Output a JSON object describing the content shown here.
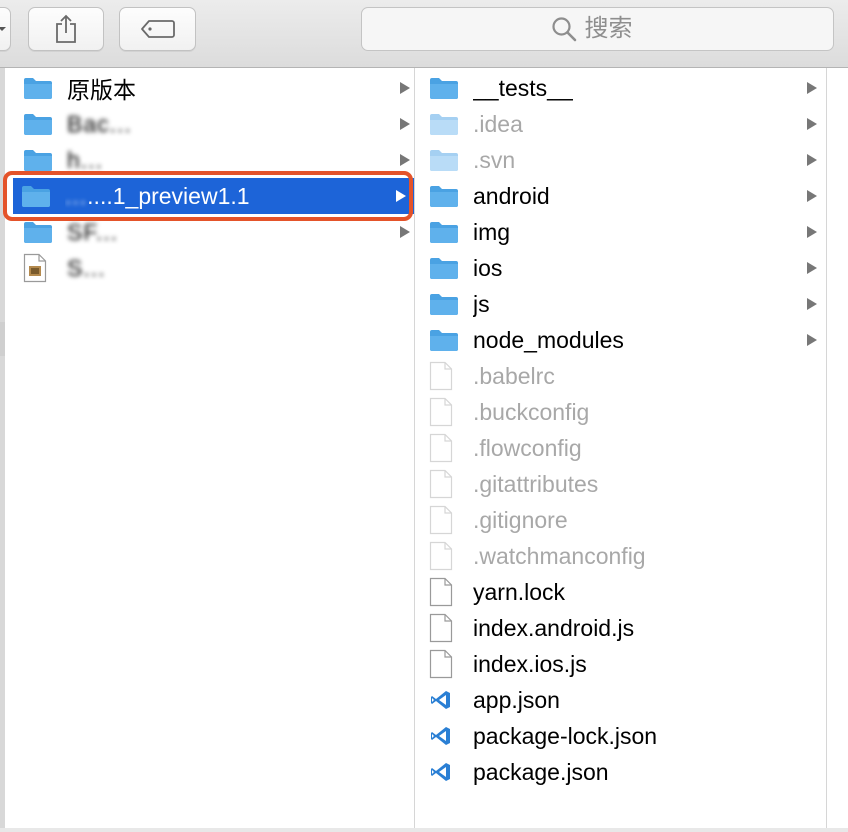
{
  "toolbar": {
    "search_placeholder": "搜索",
    "share_icon": "share-icon",
    "tag_icon": "tag-icon"
  },
  "left_column": {
    "items": [
      {
        "name": "原版本",
        "kind": "folder",
        "arrow": true
      },
      {
        "name": "Bac...",
        "kind": "folder",
        "arrow": true,
        "obscured": true
      },
      {
        "name": "h...",
        "kind": "folder",
        "arrow": true,
        "obscured": true
      },
      {
        "name_prefix": "...",
        "name_suffix": "....1_preview1.1",
        "kind": "folder",
        "arrow": true,
        "selected": true
      },
      {
        "name": "SF...",
        "kind": "folder",
        "arrow": true,
        "obscured": true
      },
      {
        "name": "S...",
        "kind": "document",
        "arrow": false,
        "obscured": true
      }
    ]
  },
  "right_column": {
    "items": [
      {
        "name": "__tests__",
        "kind": "folder",
        "dim": false,
        "arrow": true
      },
      {
        "name": ".idea",
        "kind": "folder",
        "dim": true,
        "arrow": true
      },
      {
        "name": ".svn",
        "kind": "folder",
        "dim": true,
        "arrow": true
      },
      {
        "name": "android",
        "kind": "folder",
        "dim": false,
        "arrow": true
      },
      {
        "name": "img",
        "kind": "folder",
        "dim": false,
        "arrow": true
      },
      {
        "name": "ios",
        "kind": "folder",
        "dim": false,
        "arrow": true
      },
      {
        "name": "js",
        "kind": "folder",
        "dim": false,
        "arrow": true
      },
      {
        "name": "node_modules",
        "kind": "folder",
        "dim": false,
        "arrow": true
      },
      {
        "name": ".babelrc",
        "kind": "file",
        "dim": true,
        "arrow": false
      },
      {
        "name": ".buckconfig",
        "kind": "file",
        "dim": true,
        "arrow": false
      },
      {
        "name": ".flowconfig",
        "kind": "file",
        "dim": true,
        "arrow": false
      },
      {
        "name": ".gitattributes",
        "kind": "file",
        "dim": true,
        "arrow": false
      },
      {
        "name": ".gitignore",
        "kind": "file",
        "dim": true,
        "arrow": false
      },
      {
        "name": ".watchmanconfig",
        "kind": "file",
        "dim": true,
        "arrow": false
      },
      {
        "name": "yarn.lock",
        "kind": "file",
        "dim": false,
        "arrow": false
      },
      {
        "name": "index.android.js",
        "kind": "file",
        "dim": false,
        "arrow": false
      },
      {
        "name": "index.ios.js",
        "kind": "file",
        "dim": false,
        "arrow": false
      },
      {
        "name": "app.json",
        "kind": "vscode",
        "dim": false,
        "arrow": false
      },
      {
        "name": "package-lock.json",
        "kind": "vscode",
        "dim": false,
        "arrow": false
      },
      {
        "name": "package.json",
        "kind": "vscode",
        "dim": false,
        "arrow": false
      }
    ]
  },
  "colors": {
    "selection": "#1d64d8",
    "highlight_outline": "#e4532a",
    "folder": "#5fb1ec",
    "dim_text": "#a8a8a8",
    "vscode": "#2a7fd4"
  }
}
